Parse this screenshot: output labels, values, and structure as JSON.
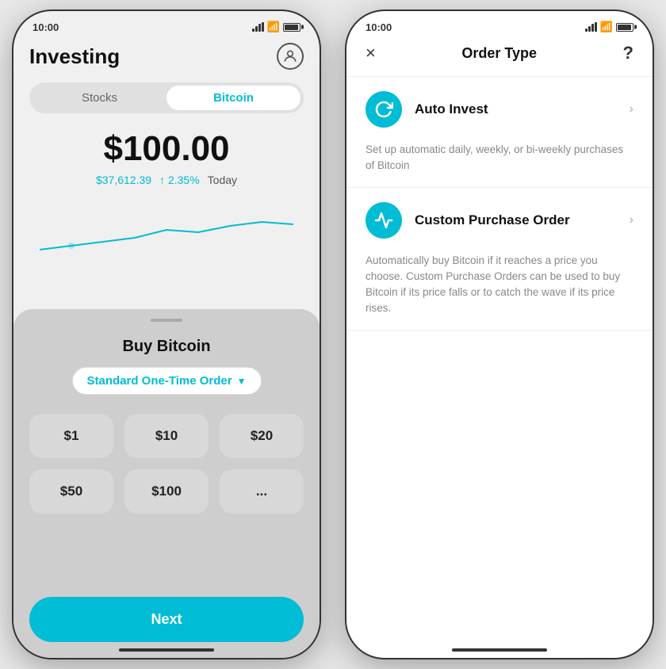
{
  "left_phone": {
    "status_bar": {
      "time": "10:00"
    },
    "header": {
      "title": "Investing",
      "avatar_label": "user avatar"
    },
    "tabs": [
      "Stocks",
      "Bitcoin"
    ],
    "active_tab": "Bitcoin",
    "price": "$100.00",
    "btc_price": "$37,612.39",
    "change": "↑ 2.35%",
    "period": "Today",
    "sheet": {
      "title": "Buy Bitcoin",
      "order_type": "Standard One-Time Order",
      "amounts": [
        "$1",
        "$10",
        "$20",
        "$50",
        "$100",
        "..."
      ],
      "next_button": "Next"
    }
  },
  "right_phone": {
    "status_bar": {
      "time": "10:00"
    },
    "header": {
      "close_label": "×",
      "title": "Order Type",
      "help_label": "?"
    },
    "options": [
      {
        "id": "auto-invest",
        "icon": "↺",
        "label": "Auto Invest",
        "description": "Set up automatic daily, weekly, or bi-weekly purchases of Bitcoin"
      },
      {
        "id": "custom-purchase",
        "icon": "⚡",
        "label": "Custom Purchase Order",
        "description": "Automatically buy Bitcoin if it reaches a price you choose. Custom Purchase Orders can be used to buy Bitcoin if its price falls or to catch the wave if its price rises."
      }
    ]
  }
}
